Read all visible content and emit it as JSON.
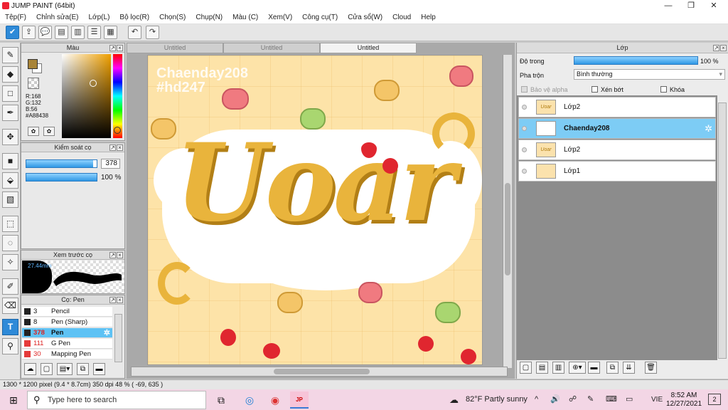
{
  "window": {
    "title": "JUMP PAINT (64bit)",
    "min": "—",
    "max": "❐",
    "close": "✕"
  },
  "menu": [
    "Tệp(F)",
    "Chỉnh sửa(E)",
    "Lớp(L)",
    "Bộ lọc(R)",
    "Chọn(S)",
    "Chụp(N)",
    "Màu (C)",
    "Xem(V)",
    "Công cụ(T)",
    "Cửa sổ(W)",
    "Cloud",
    "Help"
  ],
  "color_panel": {
    "title": "Màu",
    "r": "R:168",
    "g": "G:132",
    "b": "B:56",
    "hex": "#A88438",
    "fg_color": "#A88438",
    "bg_color": "#ffffff"
  },
  "brush_control": {
    "title": "Kiểm soát cọ",
    "size": "378",
    "opacity": "100 %",
    "size_fraction": 0.95,
    "opacity_fraction": 1.0
  },
  "brush_preview": {
    "title": "Xem trước cọ",
    "size_label": "27.44mm"
  },
  "brush_list": {
    "title": "Cọ: Pen",
    "items": [
      {
        "num": "3",
        "name": "Pencil",
        "color": "#222222"
      },
      {
        "num": "8",
        "name": "Pen (Sharp)",
        "color": "#222222"
      },
      {
        "num": "378",
        "name": "Pen",
        "color": "#222222",
        "selected": true
      },
      {
        "num": "111",
        "name": "G Pen",
        "color": "#e53b3b"
      },
      {
        "num": "30",
        "name": "Mapping Pen",
        "color": "#e53b3b"
      }
    ]
  },
  "tabs": [
    "Untitled",
    "Untitled",
    "Untitled"
  ],
  "canvas": {
    "watermark": "Chaenday208",
    "hashtag": "#hd247",
    "art_text": "Uoar"
  },
  "layers_panel": {
    "title": "Lớp",
    "opacity_label": "Độ trong",
    "opacity_value": "100 %",
    "opacity_fraction": 1.0,
    "blend_label": "Pha trộn",
    "blend_value": "Bình thường",
    "protect_alpha": "Bảo vệ alpha",
    "clipping": "Xén bớt",
    "lock": "Khóa",
    "layers": [
      {
        "name": "Lớp2",
        "thumb": "Uoar"
      },
      {
        "name": "Chaenday208",
        "selected": true,
        "thumb": ""
      },
      {
        "name": "Lớp2",
        "thumb": "Uoar"
      },
      {
        "name": "Lớp1",
        "thumb": ""
      }
    ]
  },
  "status": "1300 * 1200 pixel  (9.4 * 8.7cm)  350 dpi  48 %  ( -69, 635 )",
  "taskbar": {
    "search_placeholder": "Type here to search",
    "weather": "82°F  Partly sunny",
    "lang": "VIE",
    "time": "8:52 AM",
    "date": "12/27/2021",
    "notifications": "2"
  }
}
